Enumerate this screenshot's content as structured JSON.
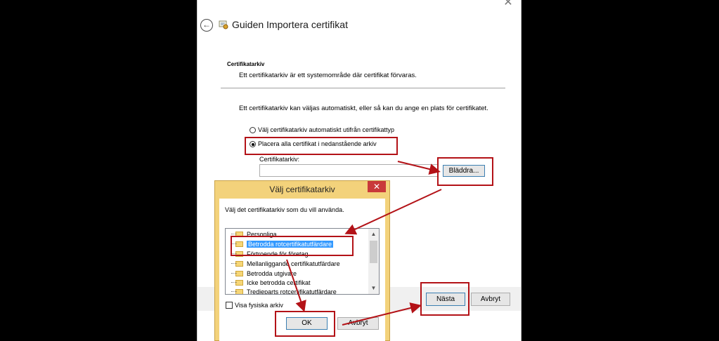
{
  "wizard": {
    "title": "Guiden Importera certifikat",
    "section_title": "Certifikatarkiv",
    "section_desc": "Ett certifikatarkiv är ett systemområde där certifikat förvaras.",
    "info": "Ett certifikatarkiv kan väljas automatiskt, eller så kan du ange en plats för certifikatet.",
    "radio_auto": "Välj certifikatarkiv automatiskt utifrån certifikattyp",
    "radio_place": "Placera alla certifikat i nedanstående arkiv",
    "radio_selected": "place",
    "store_label": "Certifikatarkiv:",
    "store_value": "",
    "browse": "Bläddra...",
    "next": "Nästa",
    "cancel": "Avbryt",
    "close_glyph": "✕",
    "back_glyph": "←"
  },
  "dialog": {
    "title": "Välj certifikatarkiv",
    "description": "Välj det certifikatarkiv som du vill använda.",
    "stores": [
      "Personliga",
      "Betrodda rotcertifikatutfärdare",
      "Förtroende för företag",
      "Mellanliggande certifikatutfärdare",
      "Betrodda utgivare",
      "Icke betrodda certifikat",
      "Tredjeparts rotcertifikatutfärdare"
    ],
    "selected_store": "Betrodda rotcertifikatutfärdare",
    "show_physical": "Visa fysiska arkiv",
    "show_physical_checked": false,
    "ok": "OK",
    "cancel": "Avbryt",
    "close_glyph": "✕"
  },
  "colors": {
    "annotation": "#b31217",
    "dialog_frame": "#f3d27b",
    "selection": "#3399ff",
    "close_red": "#c9393a"
  }
}
